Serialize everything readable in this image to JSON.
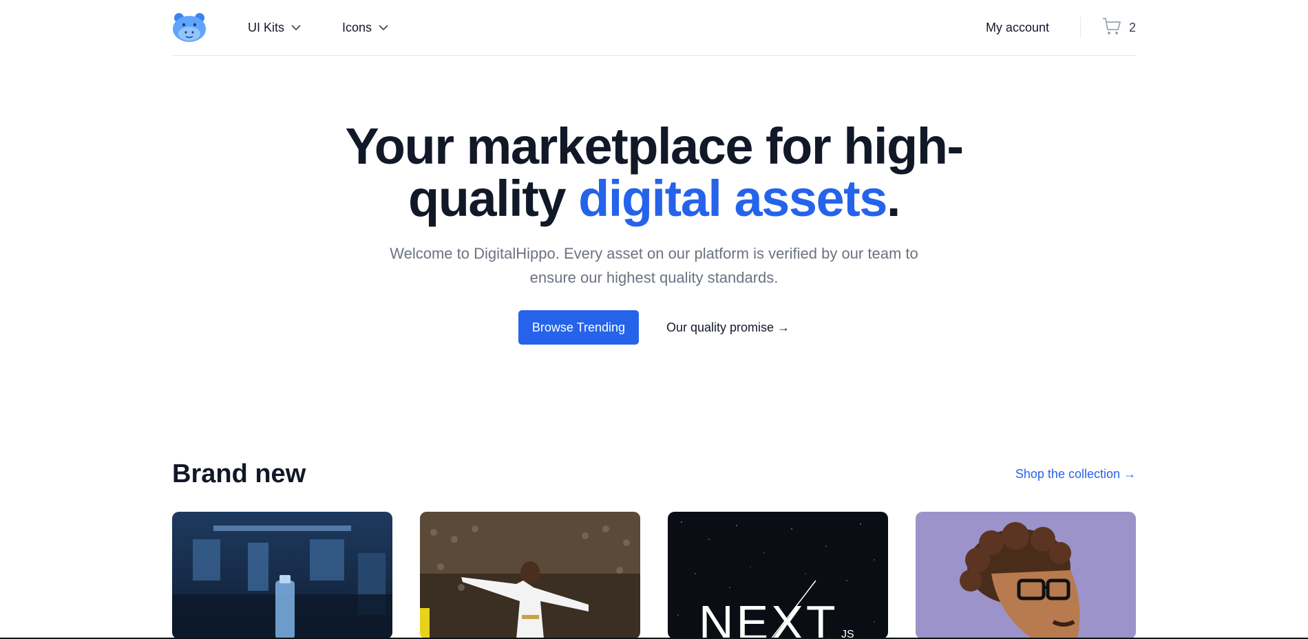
{
  "nav": {
    "logo_icon": "hippo-logo-icon",
    "items": [
      {
        "label": "UI Kits"
      },
      {
        "label": "Icons"
      }
    ],
    "account_label": "My account",
    "cart_count": "2",
    "cart_icon": "shopping-cart-icon"
  },
  "hero": {
    "title_main": "Your marketplace for high-quality ",
    "title_accent": "digital assets",
    "title_end": ".",
    "subtitle": "Welcome to DigitalHippo. Every asset on our platform is verified by our team to ensure our highest quality standards.",
    "primary_button": "Browse Trending",
    "secondary_button": "Our quality promise →"
  },
  "brand_new": {
    "title": "Brand new",
    "link": "Shop the collection →"
  },
  "products": [
    {
      "image_icon": "water-bottle-gym-image"
    },
    {
      "image_icon": "football-player-celebrating-image"
    },
    {
      "image_icon": "nextjs-logo-image",
      "text": "NEXT",
      "text_small": "JS"
    },
    {
      "image_icon": "cartoon-avatar-glasses-image"
    }
  ],
  "colors": {
    "accent": "#2563eb",
    "text_dark": "#111827",
    "text_muted": "#6b7280",
    "border": "#e5e7eb"
  }
}
